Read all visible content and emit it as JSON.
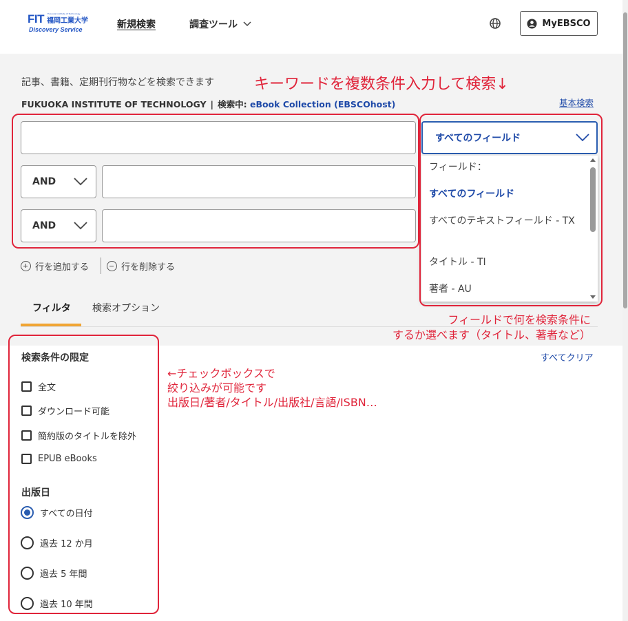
{
  "header": {
    "logo": {
      "main": "FIT",
      "university": "福岡工業大学",
      "university_en": "Fukuoka Institute of Technology",
      "service": "Discovery Service"
    },
    "nav_new_search": "新規検索",
    "nav_tools": "調査ツール",
    "myebsco": "MyEBSCO"
  },
  "search": {
    "description": "記事、書籍、定期刊行物などを検索できます",
    "annotation": "キーワードを複数条件入力して検索↓",
    "institution": "FUKUOKA INSTITUTE OF TECHNOLOGY",
    "searching_label": "検索中:",
    "database": "eBook Collection (EBSCOhost)",
    "basic_search": "基本検索",
    "rows": [
      {
        "value": ""
      },
      {
        "operator": "AND",
        "value": ""
      },
      {
        "operator": "AND",
        "value": ""
      }
    ],
    "field_select": "すべてのフィールド",
    "field_options": {
      "header": "フィールド：",
      "items": [
        "すべてのフィールド",
        "すべてのテキストフィールド - TX",
        "タイトル - TI",
        "著者 - AU"
      ]
    },
    "add_row": "行を追加する",
    "remove_row": "行を削除する"
  },
  "tabs": {
    "filter": "フィルタ",
    "options": "検索オプション"
  },
  "annotations": {
    "field_note_line1": "フィールドで何を検索条件に",
    "field_note_line2": "するか選べます（タイトル、著者など）",
    "filter_note_line1": "←チェックボックスで",
    "filter_note_line2": "絞り込みが可能です",
    "filter_note_line3": "出版日/著者/タイトル/出版社/言語/ISBN…"
  },
  "filters": {
    "clear_all": "すべてクリア",
    "limit_title": "検索条件の限定",
    "checkboxes": [
      "全文",
      "ダウンロード可能",
      "簡約版のタイトルを除外",
      "EPUB eBooks"
    ],
    "pubdate_title": "出版日",
    "pubdate_options": [
      "すべての日付",
      "過去 12 か月",
      "過去 5 年間",
      "過去 10 年間"
    ],
    "pubdate_selected": "すべての日付"
  },
  "colors": {
    "accent": "#2a5db0",
    "annotation_red": "#e0243a",
    "tab_underline": "#f0a533",
    "link": "#1f4aa8"
  }
}
